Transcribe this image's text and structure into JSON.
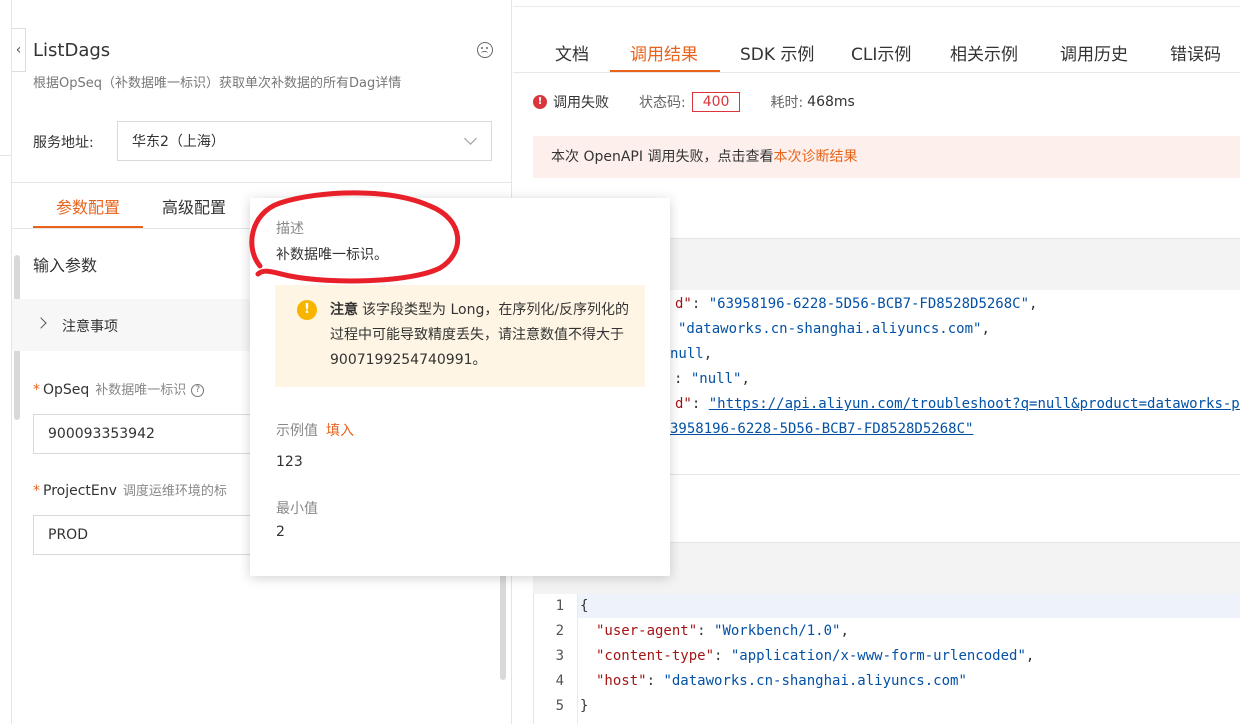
{
  "api": {
    "title": "ListDags",
    "description": "根据OpSeq（补数据唯一标识）获取单次补数据的所有Dag详情",
    "endpoint_label": "服务地址:",
    "endpoint_value": "华东2（上海）"
  },
  "left_tabs": {
    "params": "参数配置",
    "advanced": "高级配置"
  },
  "input_params_title": "输入参数",
  "notice_label": "注意事项",
  "fields": [
    {
      "name": "OpSeq",
      "required_mark": "*",
      "desc": "补数据唯一标识",
      "value": "900093353942"
    },
    {
      "name": "ProjectEnv",
      "required_mark": "*",
      "desc": "调度运维环境的标",
      "value": "PROD"
    }
  ],
  "right_tabs": [
    "文档",
    "调用结果",
    "SDK 示例",
    "CLI示例",
    "相关示例",
    "调用历史",
    "错误码"
  ],
  "active_right_tab": "调用结果",
  "status": {
    "result": "调用失败",
    "code_label": "状态码:",
    "code": "400",
    "time_label": "耗时:",
    "time": "468ms"
  },
  "fail_banner": {
    "text": "本次 OpenAPI 调用失败，点击查看",
    "link": "本次诊断结果"
  },
  "response_lines": [
    {
      "key": "d\"",
      "value": "\"63958196-6228-5D56-BCB7-FD8528D5268C\"",
      "tail": ","
    },
    {
      "key": "",
      "value": "\"dataworks.cn-shanghai.aliyuncs.com\"",
      "tail": ","
    },
    {
      "key": "",
      "value": "null",
      "tail": ","
    },
    {
      "key": "",
      "value": "\"null\"",
      "tail": ","
    },
    {
      "key": "d\"",
      "value": "\"https://api.aliyun.com/troubleshoot?q=null&product=dataworks-pub",
      "tail": ""
    },
    {
      "key": "",
      "value": "3958196-6228-5D56-BCB7-FD8528D5268C\"",
      "tail": ""
    }
  ],
  "header_lines": [
    {
      "num": "1",
      "text": "{"
    },
    {
      "num": "2",
      "key": "\"user-agent\"",
      "value": "\"Workbench/1.0\"",
      "tail": ","
    },
    {
      "num": "3",
      "key": "\"content-type\"",
      "value": "\"application/x-www-form-urlencoded\"",
      "tail": ","
    },
    {
      "num": "4",
      "key": "\"host\"",
      "value": "\"dataworks.cn-shanghai.aliyuncs.com\"",
      "tail": ""
    },
    {
      "num": "5",
      "text": "}"
    }
  ],
  "popover": {
    "desc_label": "描述",
    "desc_value": "补数据唯一标识。",
    "warn_title": "注意",
    "warn_text": "该字段类型为 Long，在序列化/反序列化的过程中可能导致精度丢失，请注意数值不得大于 9007199254740991。",
    "example_label": "示例值",
    "fill_link": "填入",
    "example_value": "123",
    "min_label": "最小值",
    "min_value": "2"
  },
  "colors": {
    "accent": "#e8631c",
    "error": "#d9363e",
    "warning": "#f7b500",
    "annotation": "#e8202a"
  }
}
